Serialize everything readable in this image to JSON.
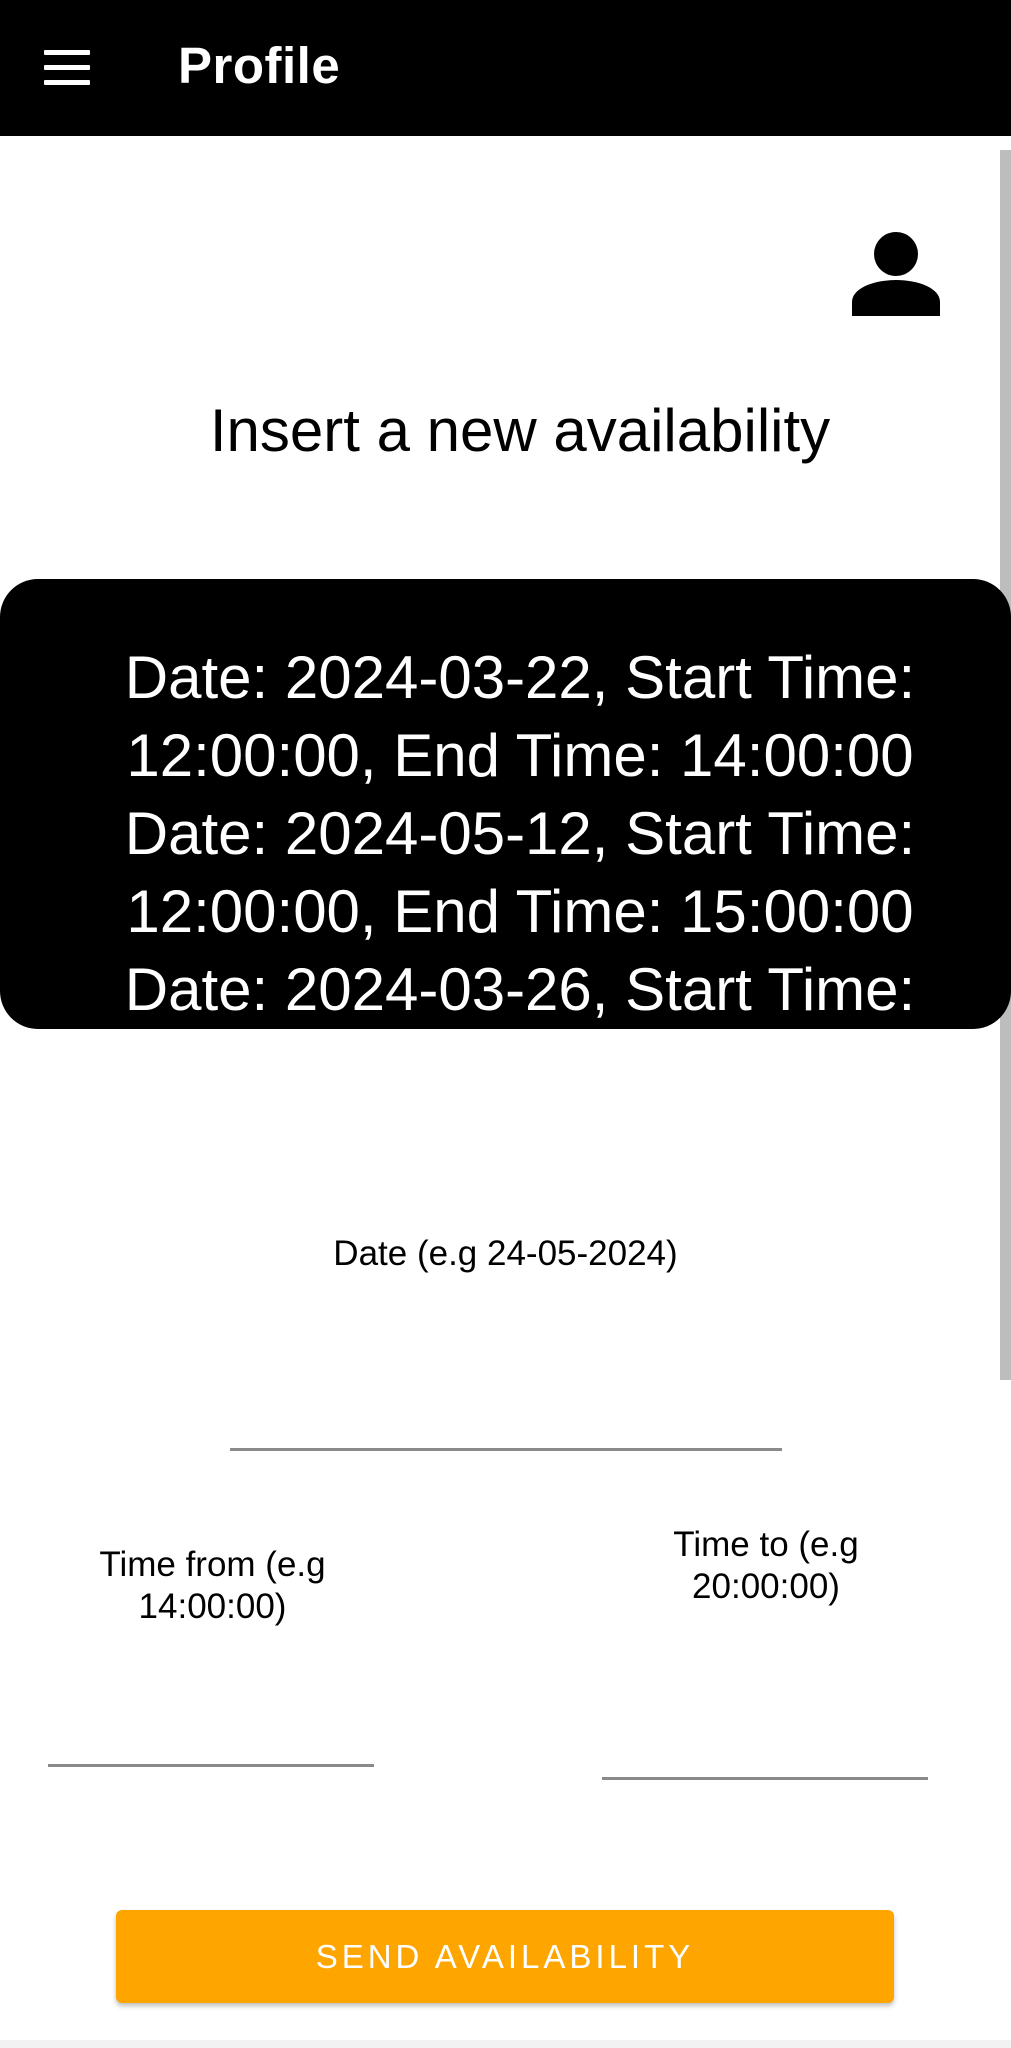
{
  "app_bar": {
    "title": "Profile",
    "menu_icon": "hamburger-menu-icon",
    "background": "#000000"
  },
  "profile": {
    "icon": "person-icon",
    "heading": "Insert a new availability"
  },
  "availability_list": {
    "items": [
      "Date: 2024-03-22, Start Time: 12:00:00, End Time: 14:00:00",
      "Date: 2024-05-12, Start Time: 12:00:00, End Time: 15:00:00",
      "Date: 2024-03-26, Start Time:"
    ],
    "text": "Date: 2024-03-22, Start Time:\n12:00:00, End Time: 14:00:00\nDate: 2024-05-12, Start Time:\n12:00:00, End Time: 15:00:00\nDate: 2024-03-26, Start Time:"
  },
  "form": {
    "date_label": "Date (e.g 24-05-2024)",
    "date_value": "",
    "time_from_label": "Time from (e.g\n14:00:00)",
    "time_from_value": "",
    "time_to_label": "Time to (e.g\n20:00:00)",
    "time_to_value": "",
    "send_button_label": "SEND AVAILABILITY"
  },
  "colors": {
    "accent": "#ffa500",
    "dark": "#000000"
  }
}
